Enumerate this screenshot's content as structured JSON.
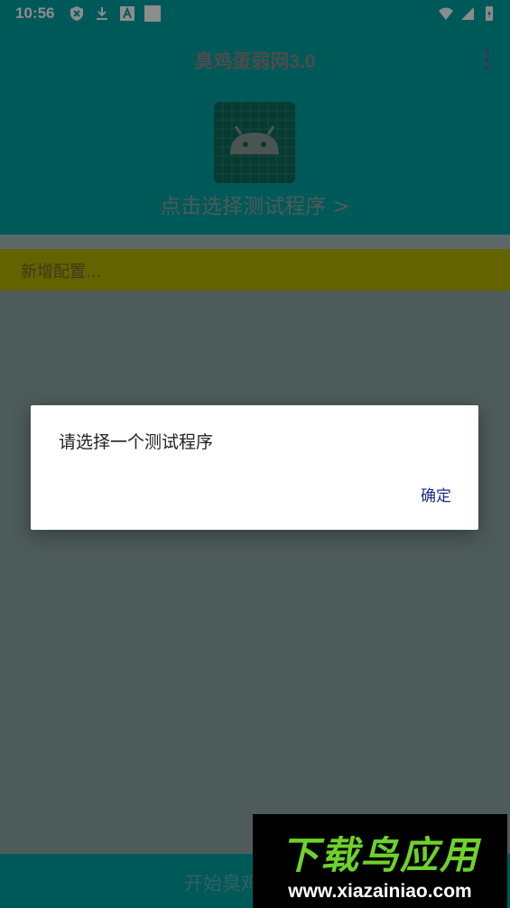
{
  "status_bar": {
    "time": "10:56",
    "left_icons": [
      "vpn-shield-icon",
      "download-icon",
      "a-badge-icon",
      "square-notification-icon"
    ],
    "right_icons": [
      "wifi-icon",
      "signal-icon",
      "battery-charging-icon"
    ]
  },
  "app_bar": {
    "title": "臭鸡蛋弱网3.0",
    "menu_icon": "overflow-menu-icon"
  },
  "selector": {
    "icon": "android-robot-icon",
    "label": "点击选择测试程序 >"
  },
  "config": {
    "label": "新增配置..."
  },
  "bottom_bar": {
    "label": "开始臭鸡"
  },
  "dialog": {
    "message": "请选择一个测试程序",
    "ok_label": "确定"
  },
  "watermark": {
    "title": "下载鸟应用",
    "url": "www.xiazainiao.com"
  },
  "colors": {
    "primary": "#00a2a2",
    "config_row": "#b5b500",
    "dialog_button": "#1f2a8a",
    "watermark_green": "#6ed12c"
  }
}
